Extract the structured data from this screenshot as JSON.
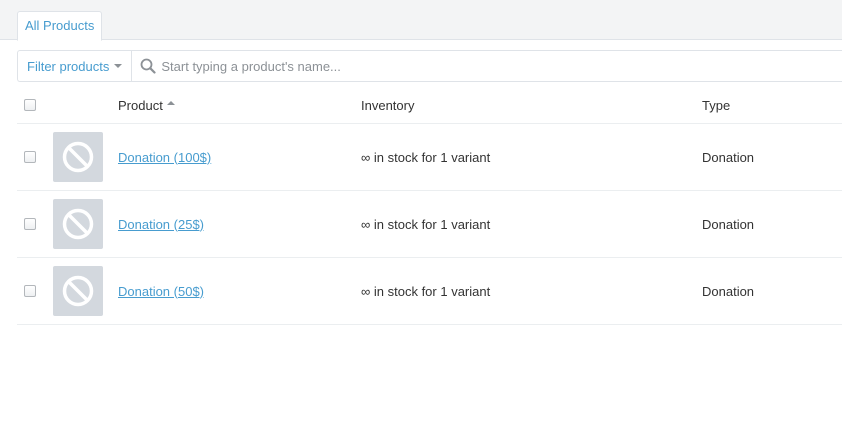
{
  "tabs": [
    {
      "label": "All Products",
      "active": true
    }
  ],
  "filter": {
    "label": "Filter products",
    "search_placeholder": "Start typing a product's name..."
  },
  "table": {
    "columns": [
      {
        "label": "Product",
        "sort": "ascending"
      },
      {
        "label": "Inventory"
      },
      {
        "label": "Type"
      }
    ],
    "rows": [
      {
        "product": "Donation (100$)",
        "inventory": "∞ in stock for 1 variant",
        "type": "Donation",
        "thumbnail_icon": "no-image-icon"
      },
      {
        "product": "Donation (25$)",
        "inventory": "∞ in stock for 1 variant",
        "type": "Donation",
        "thumbnail_icon": "no-image-icon"
      },
      {
        "product": "Donation (50$)",
        "inventory": "∞ in stock for 1 variant",
        "type": "Donation",
        "thumbnail_icon": "no-image-icon"
      }
    ]
  },
  "colors": {
    "link": "#479ccf",
    "thumbnail_bg": "#d3d8de",
    "tabbar_bg": "#f3f4f5",
    "border": "#dfe3e8"
  }
}
